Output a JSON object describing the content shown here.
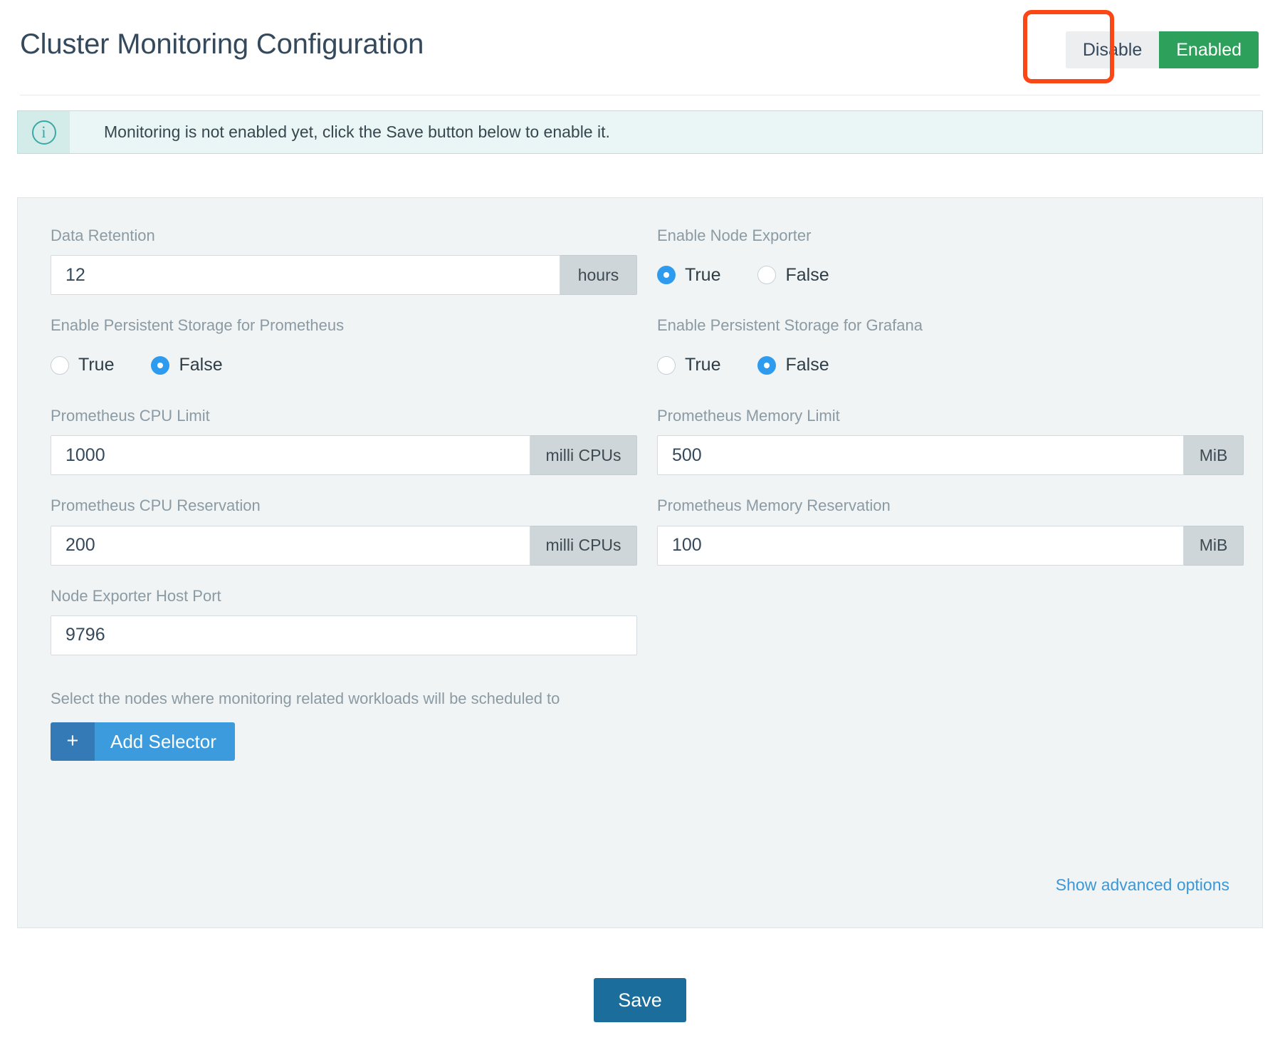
{
  "header": {
    "title": "Cluster Monitoring Configuration",
    "toggle": {
      "disable_label": "Disable",
      "enabled_label": "Enabled",
      "active": "Enabled",
      "active_color": "#2da05b",
      "highlight_color": "#fb4616"
    }
  },
  "banner": {
    "icon": "info-icon",
    "icon_glyph": "i",
    "message": "Monitoring is not enabled yet, click the Save button below to enable it."
  },
  "form": {
    "data_retention": {
      "label": "Data Retention",
      "value": "12",
      "unit": "hours"
    },
    "enable_node_exporter": {
      "label": "Enable Node Exporter",
      "options": [
        "True",
        "False"
      ],
      "selected": "True"
    },
    "persistent_storage_prometheus": {
      "label": "Enable Persistent Storage for Prometheus",
      "options": [
        "True",
        "False"
      ],
      "selected": "False"
    },
    "persistent_storage_grafana": {
      "label": "Enable Persistent Storage for Grafana",
      "options": [
        "True",
        "False"
      ],
      "selected": "False"
    },
    "prometheus_cpu_limit": {
      "label": "Prometheus CPU Limit",
      "value": "1000",
      "unit": "milli CPUs"
    },
    "prometheus_memory_limit": {
      "label": "Prometheus Memory Limit",
      "value": "500",
      "unit": "MiB"
    },
    "prometheus_cpu_reservation": {
      "label": "Prometheus CPU Reservation",
      "value": "200",
      "unit": "milli CPUs"
    },
    "prometheus_memory_reservation": {
      "label": "Prometheus Memory Reservation",
      "value": "100",
      "unit": "MiB"
    },
    "node_exporter_host_port": {
      "label": "Node Exporter Host Port",
      "value": "9796"
    },
    "node_selector": {
      "helper_text": "Select the nodes where monitoring related workloads will be scheduled to",
      "add_button_plus": "+",
      "add_button_label": "Add Selector"
    },
    "advanced_options_link": "Show advanced options"
  },
  "footer": {
    "save_label": "Save"
  }
}
